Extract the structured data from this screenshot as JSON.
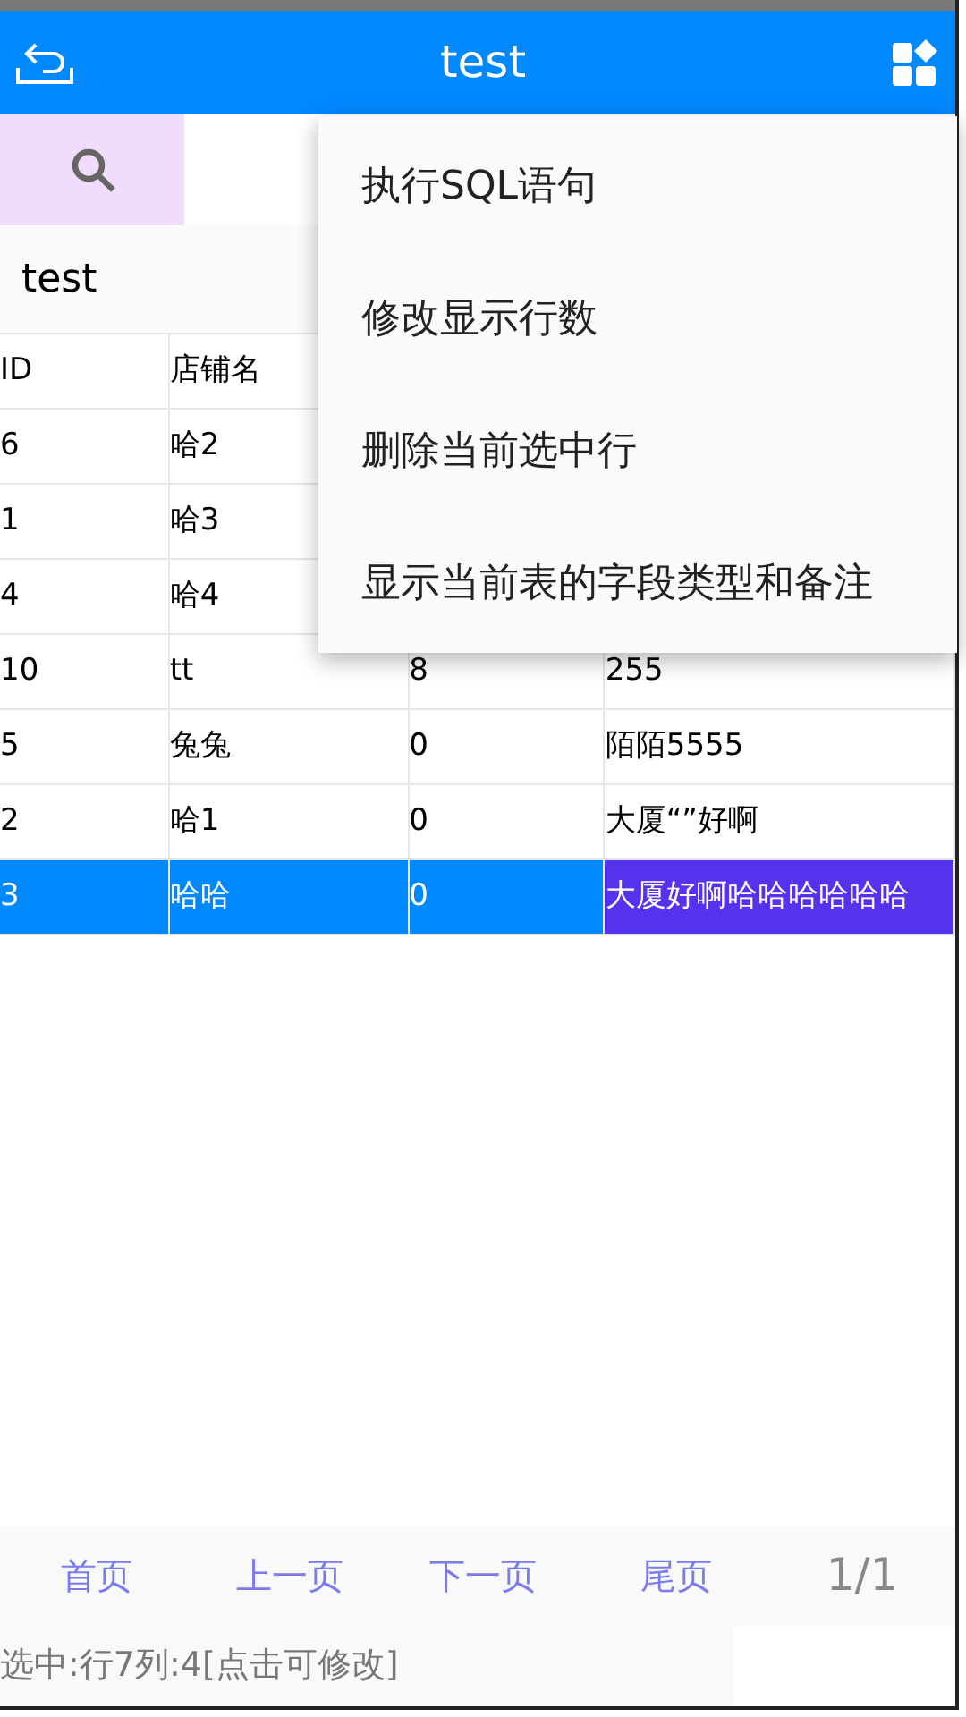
{
  "app_bar": {
    "title": "test"
  },
  "table_name": "test",
  "table": {
    "columns": [
      "ID",
      "店铺名"
    ],
    "rows": [
      {
        "selected": false,
        "cells": [
          {
            "text": "6",
            "selected": false
          },
          {
            "text": "哈2",
            "selected": false
          }
        ]
      },
      {
        "selected": false,
        "cells": [
          {
            "text": "1",
            "selected": false
          },
          {
            "text": "哈3",
            "selected": false
          }
        ]
      },
      {
        "selected": false,
        "cells": [
          {
            "text": "4",
            "selected": false
          },
          {
            "text": "哈4",
            "selected": false
          }
        ]
      },
      {
        "selected": false,
        "cells": [
          {
            "text": "10",
            "selected": false
          },
          {
            "text": "tt",
            "selected": false
          },
          {
            "text": "8",
            "selected": false
          },
          {
            "text": "255",
            "selected": false
          }
        ]
      },
      {
        "selected": false,
        "cells": [
          {
            "text": "5",
            "selected": false
          },
          {
            "text": "兔兔",
            "selected": false
          },
          {
            "text": "0",
            "selected": false
          },
          {
            "text": "陌陌5555",
            "selected": false
          }
        ]
      },
      {
        "selected": false,
        "cells": [
          {
            "text": "2",
            "selected": false
          },
          {
            "text": "哈1",
            "selected": false
          },
          {
            "text": "0",
            "selected": false
          },
          {
            "text": "大厦“”好啊",
            "selected": false
          }
        ]
      },
      {
        "selected": true,
        "cells": [
          {
            "text": "3",
            "selected": false
          },
          {
            "text": "哈哈",
            "selected": false
          },
          {
            "text": "0",
            "selected": false
          },
          {
            "text": "大厦好啊哈哈哈哈哈哈",
            "selected": true
          }
        ]
      }
    ]
  },
  "menu": {
    "items": [
      "执行SQL语句",
      "修改显示行数",
      "删除当前选中行",
      "显示当前表的字段类型和备注"
    ]
  },
  "pagination": {
    "buttons": [
      "首页",
      "上一页",
      "下一页",
      "尾页"
    ],
    "page": "1/1"
  },
  "status_bar": "选中:行7列:4[点击可修改]"
}
